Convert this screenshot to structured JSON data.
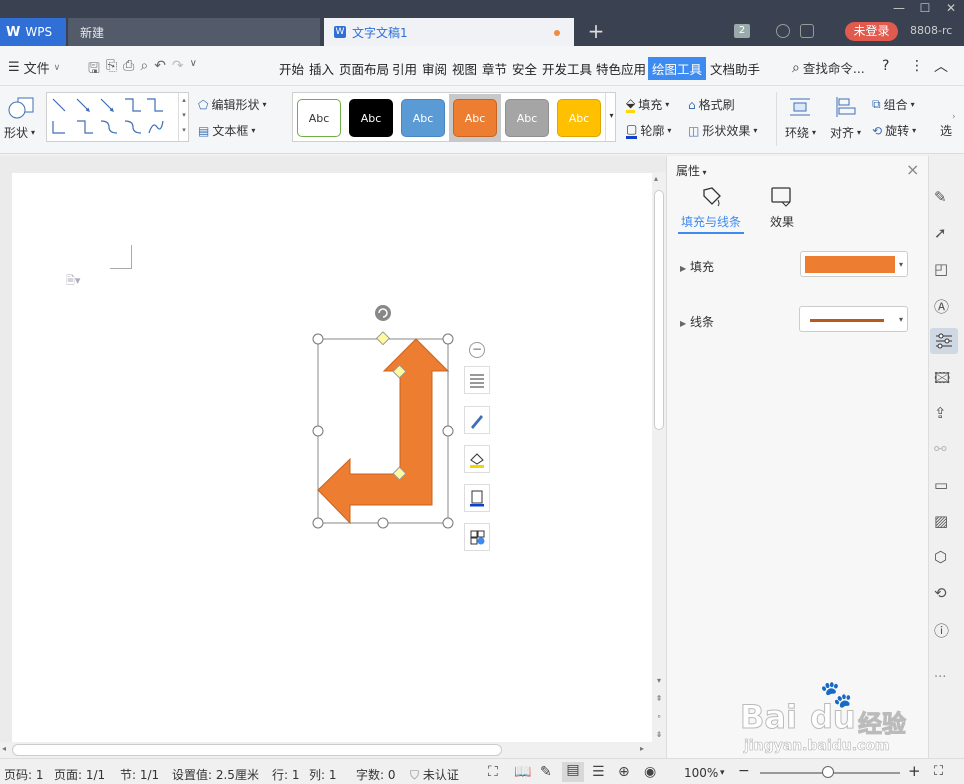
{
  "titlebar": {
    "app_label": "WPS",
    "new_tab_label": "新建",
    "doc_tab_label": "文字文稿1",
    "tab_count": "2",
    "login_label": "未登录",
    "version": "8808-rc"
  },
  "menubar": {
    "file_label": "文件",
    "items": [
      "开始",
      "插入",
      "页面布局",
      "引用",
      "审阅",
      "视图",
      "章节",
      "安全",
      "开发工具",
      "特色应用",
      "绘图工具",
      "文档助手"
    ],
    "active_item": "绘图工具",
    "search_label": "查找命令..."
  },
  "ribbon": {
    "shape_label": "形状",
    "edit_shape_label": "编辑形状",
    "textbox_label": "文本框",
    "style_swatches": [
      {
        "label": "Abc",
        "bg": "#ffffff",
        "fg": "#333333",
        "border": "#70ad47"
      },
      {
        "label": "Abc",
        "bg": "#000000",
        "fg": "#ffffff",
        "border": "#000000"
      },
      {
        "label": "Abc",
        "bg": "#5b9bd5",
        "fg": "#ffffff",
        "border": "#4a87c0"
      },
      {
        "label": "Abc",
        "bg": "#ed7d31",
        "fg": "#ffffff",
        "border": "#c8641f"
      },
      {
        "label": "Abc",
        "bg": "#a5a5a5",
        "fg": "#ffffff",
        "border": "#8f8f8f"
      },
      {
        "label": "Abc",
        "bg": "#ffc000",
        "fg": "#ffffff",
        "border": "#dca600"
      }
    ],
    "fill_label": "填充",
    "format_painter_label": "格式刷",
    "outline_label": "轮廓",
    "shape_effect_label": "形状效果",
    "wrap_label": "环绕",
    "align_label": "对齐",
    "group_label": "组合",
    "rotate_label": "旋转",
    "more_label": "选"
  },
  "properties": {
    "title": "属性",
    "tab_fill_line": "填充与线条",
    "tab_effect": "效果",
    "fill_label": "填充",
    "line_label": "线条",
    "fill_color": "#ed7d31",
    "line_color": "#b85a1e"
  },
  "shape": {
    "fill_color": "#ed7d31",
    "stroke_color": "#c8641f"
  },
  "statusbar": {
    "page_code": "页码: 1",
    "page": "页面: 1/1",
    "section": "节: 1/1",
    "setting": "设置值: 2.5厘米",
    "row": "行: 1",
    "col": "列: 1",
    "word_count": "字数: 0",
    "cert": "未认证",
    "zoom": "100%"
  },
  "watermark": {
    "brand": "Bai",
    "brand2": "du",
    "cn": "经验",
    "url": "jingyan.baidu.com"
  }
}
